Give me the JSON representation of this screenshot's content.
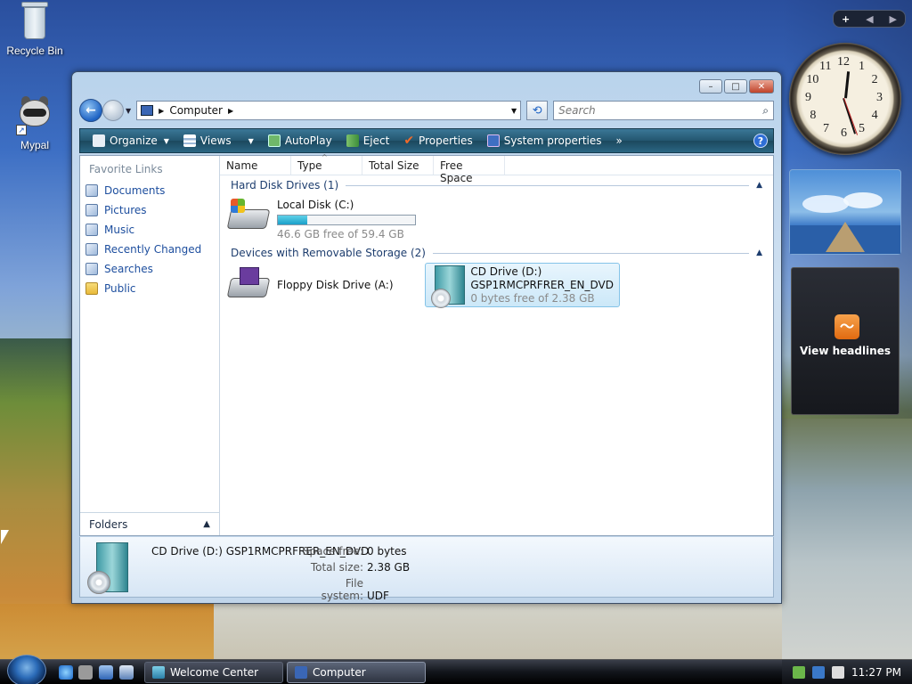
{
  "desktop": {
    "icons": [
      {
        "label": "Recycle Bin",
        "icon": "recycle-bin-icon"
      },
      {
        "label": "Mypal",
        "icon": "raccoon-shortcut-icon"
      }
    ]
  },
  "window": {
    "controls": {
      "minimize": "–",
      "maximize": "□",
      "close": "✕"
    },
    "address": {
      "location": "Computer"
    },
    "search": {
      "placeholder": "Search"
    },
    "toolbar": {
      "organize": "Organize",
      "views": "Views",
      "autoplay": "AutoPlay",
      "eject": "Eject",
      "properties": "Properties",
      "system_properties": "System properties",
      "more": "»",
      "help": "?"
    },
    "nav_pane": {
      "heading": "Favorite Links",
      "links": [
        "Documents",
        "Pictures",
        "Music",
        "Recently Changed",
        "Searches",
        "Public"
      ],
      "folders_label": "Folders"
    },
    "columns": [
      "Name",
      "Type",
      "Total Size",
      "Free Space"
    ],
    "groups": {
      "hard_disks": "Hard Disk Drives (1)",
      "removable": "Devices with Removable Storage (2)"
    },
    "drives": {
      "local": {
        "name": "Local Disk (C:)",
        "free_text": "46.6 GB free of 59.4 GB",
        "used_fraction": 0.215
      },
      "floppy": {
        "name": "Floppy Disk Drive (A:)"
      },
      "cd": {
        "name": "CD Drive (D:)",
        "label": "GSP1RMCPRFRER_EN_DVD",
        "free_text": "0 bytes free of 2.38 GB"
      }
    },
    "details": {
      "title": "CD Drive (D:) GSP1RMCPRFRER_EN_DVD",
      "space_free_label": "Space free:",
      "space_free": "0 bytes",
      "total_size_label": "Total size:",
      "total_size": "2.38 GB",
      "file_system_label": "File system:",
      "file_system": "UDF"
    }
  },
  "gadgets": {
    "feed_label": "View headlines",
    "clock_numbers": [
      "12",
      "1",
      "2",
      "3",
      "4",
      "5",
      "6",
      "7",
      "8",
      "9",
      "10",
      "11"
    ]
  },
  "taskbar": {
    "tasks": [
      "Welcome Center",
      "Computer"
    ],
    "time": "11:27 PM"
  }
}
